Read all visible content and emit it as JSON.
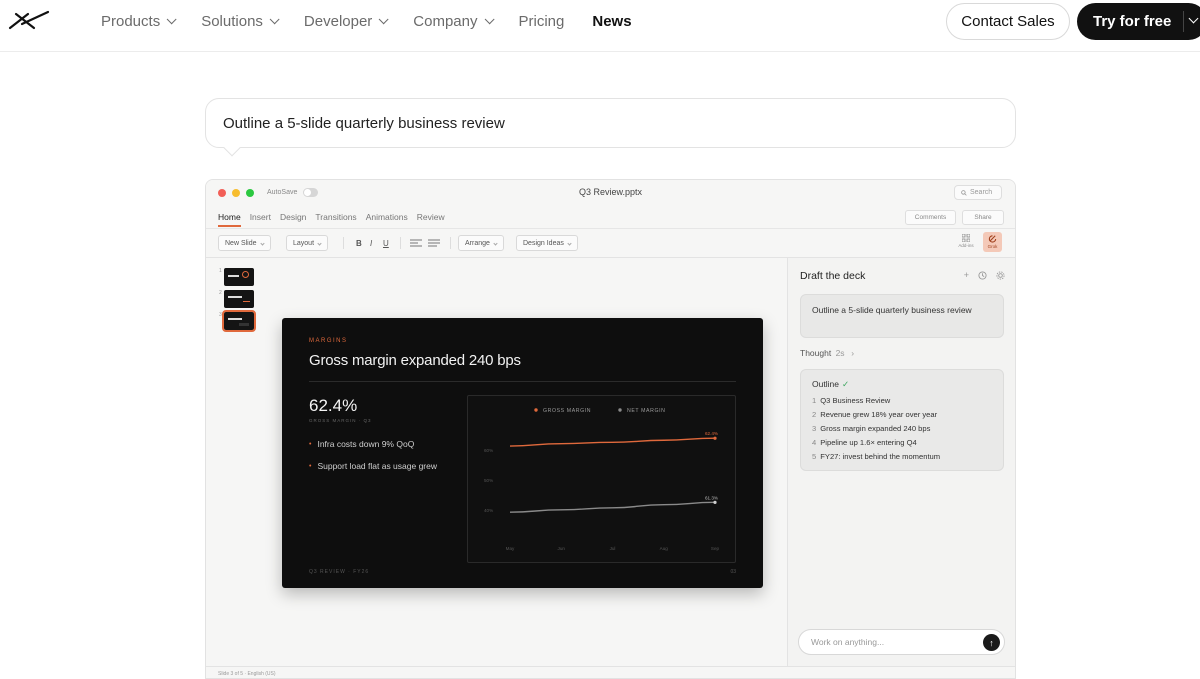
{
  "nav": {
    "links": [
      {
        "label": "Products",
        "has_menu": true
      },
      {
        "label": "Solutions",
        "has_menu": true
      },
      {
        "label": "Developer",
        "has_menu": true
      },
      {
        "label": "Company",
        "has_menu": true
      },
      {
        "label": "Pricing",
        "has_menu": false
      },
      {
        "label": "News",
        "has_menu": false,
        "active": true
      }
    ],
    "contact_label": "Contact Sales",
    "try_label": "Try for free"
  },
  "prompt": {
    "text": "Outline a 5-slide quarterly business review"
  },
  "app": {
    "autosave_label": "AutoSave",
    "doc_title": "Q3 Review.pptx",
    "search_label": "Search",
    "tabs": [
      "Home",
      "Insert",
      "Design",
      "Transitions",
      "Animations",
      "Review"
    ],
    "comments_label": "Comments",
    "share_label": "Share",
    "toolbar": {
      "new_slide": "New Slide",
      "layout": "Layout",
      "bold": "B",
      "italic": "I",
      "underline": "U",
      "arrange": "Arrange",
      "design_ideas": "Design Ideas",
      "addins": "Add-ins",
      "grok": "Grok"
    },
    "thumb_numbers": [
      "1",
      "2",
      "3"
    ],
    "slide": {
      "kicker": "MARGINS",
      "heading": "Gross margin expanded 240 bps",
      "stat": "62.4%",
      "stat_label": "GROSS MARGIN · Q3",
      "bullets": [
        "Infra costs down 9% QoQ",
        "Support load flat as usage grew"
      ],
      "footer_left": "Q3 REVIEW · FY26",
      "footer_right": "03"
    },
    "status": "Slide 3 of 5 · English (US)"
  },
  "panel": {
    "title": "Draft the deck",
    "user_message": "Outline a 5-slide quarterly business review",
    "thought_label": "Thought",
    "thought_time": "2s",
    "outline_title": "Outline",
    "outline_items": [
      "Q3 Business Review",
      "Revenue grew 18% year over year",
      "Gross margin expanded 240 bps",
      "Pipeline up 1.6× entering Q4",
      "FY27: invest behind the momentum"
    ],
    "composer_placeholder": "Work on anything..."
  },
  "colors": {
    "accent": "#e0693c",
    "net_line": "#8a8a8a",
    "brand_dark": "#111111"
  },
  "chart_data": {
    "type": "line",
    "categories": [
      "May",
      "Jun",
      "Jul",
      "Aug",
      "Sep"
    ],
    "series": [
      {
        "name": "GROSS MARGIN",
        "values": [
          60.1,
          60.8,
          61.2,
          61.8,
          62.4
        ],
        "color": "#e0693c"
      },
      {
        "name": "NET MARGIN",
        "values": [
          40.6,
          41.3,
          41.9,
          42.8,
          43.5
        ],
        "color": "#8a8a8a"
      }
    ],
    "end_labels": [
      "62.4%",
      "61.3%"
    ],
    "y_tick_labels": [
      "60%",
      "50%",
      "40%"
    ],
    "title": "",
    "xlabel": "",
    "ylabel": "",
    "legend_position": "top-center",
    "grid": false
  }
}
